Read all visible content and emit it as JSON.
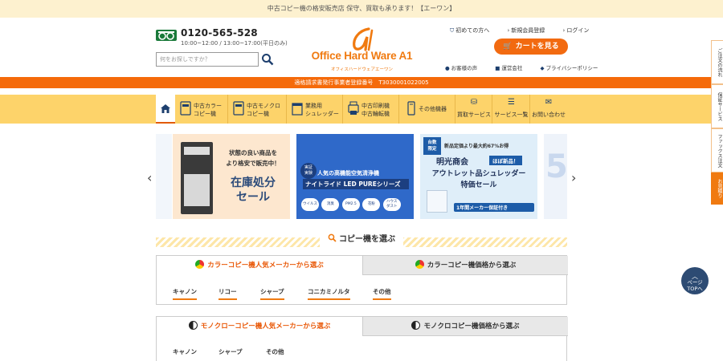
{
  "topbar": {
    "text": "中古コピー機の格安販売店 保守、買取も承ります！【エーワン】"
  },
  "header": {
    "phone": "0120-565-528",
    "hours": "10:00~12:00 / 13:00~17:00(平日のみ)",
    "search_placeholder": "何をお探しですか？",
    "logo_text": "Office Hard Ware A1",
    "logo_sub": "オフィスハードウェアエーワン",
    "links_top": [
      "初めての方へ",
      "新規会員登録",
      "ログイン"
    ],
    "cart_label": "カートを見る",
    "links_bottom": [
      "お客様の声",
      "運営会社",
      "プライバシーポリシー"
    ]
  },
  "invoice_text": "適格請求書発行事業者登録番号　T3030001022005",
  "nav": [
    {
      "label": "中古カラー\nコピー機"
    },
    {
      "label": "中古モノクロ\nコピー機"
    },
    {
      "label": "業務用\nシュレッダー"
    },
    {
      "label": "中古印刷機\n中古輪転機"
    },
    {
      "label": "その他機器"
    },
    {
      "label": "買取サービス"
    },
    {
      "label": "サービス一覧"
    },
    {
      "label": "お問い合わせ"
    }
  ],
  "slides": {
    "s1": {
      "line1": "状態の良い商品を",
      "line2": "より格安で販売中！",
      "big": "在庫処分\nセール"
    },
    "s2": {
      "badge": "実証\n実験",
      "line1": "人気の高機能空気清浄機",
      "line2": "ナイトライド LED PUREシリーズ",
      "tags": [
        "ウイルス",
        "消臭",
        "PM2.5",
        "花粉",
        "ハウス\nダスト"
      ]
    },
    "s3": {
      "badge": "台数\n限定",
      "top": "新品定価より最大約67%お得",
      "brand": "明光商会",
      "tag": "ほぼ新品！",
      "line1": "アウトレット品シュレッダー",
      "line2": "特価セール",
      "bottom": "1年間メーカー保証付き"
    }
  },
  "section_title": "コピー機を選ぶ",
  "color_panel": {
    "tab_left": "カラーコピー機人気メーカーから選ぶ",
    "tab_right": "カラーコピー機価格から選ぶ",
    "makers": [
      "キャノン",
      "リコー",
      "シャープ",
      "コニカミノルタ",
      "その他"
    ]
  },
  "mono_panel": {
    "tab_left": "モノクローコピー機人気メーカーから選ぶ",
    "tab_right": "モノクロコピー機価格から選ぶ",
    "makers": [
      "キャノン",
      "シャープ",
      "その他"
    ]
  },
  "side_tabs": [
    "ご注文の流れ",
    "保証サービス",
    "ファックス注文",
    "お見積り"
  ],
  "pagetop": "ページ\nTOPへ",
  "colors": {
    "accent": "#f07a10",
    "nav_bg": "#fdd36a",
    "invoice_bg": "#f56a0a",
    "pagetop_bg": "#2d4b73"
  }
}
